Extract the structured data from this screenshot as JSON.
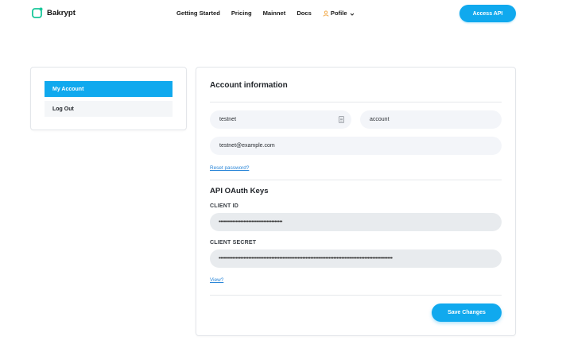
{
  "header": {
    "brand": "Bakrypt",
    "nav": [
      "Getting Started",
      "Pricing",
      "Mainnet",
      "Docs"
    ],
    "profile_label": "Pofile",
    "access_button": "Access API",
    "accent_color": "#10a9ee"
  },
  "sidebar": {
    "items": [
      {
        "label": "My Account",
        "active": true
      },
      {
        "label": "Log Out",
        "active": false
      }
    ]
  },
  "account": {
    "title": "Account information",
    "first_name": "testnet",
    "last_name": "account",
    "email": "testnet@example.com",
    "reset_link": "Reset password?"
  },
  "oauth": {
    "title": "API OAuth Keys",
    "client_id_label": "CLIENT ID",
    "client_id_value": "•••••••••••••••••••••••••••••••••••••••••",
    "client_secret_label": "CLIENT SECRET",
    "client_secret_value": "••••••••••••••••••••••••••••••••••••••••••••••••••••••••••••••••••••••••••••••••••••••••••••••••••••••••••••••••",
    "view_link": "View?"
  },
  "actions": {
    "save": "Save Changes"
  }
}
